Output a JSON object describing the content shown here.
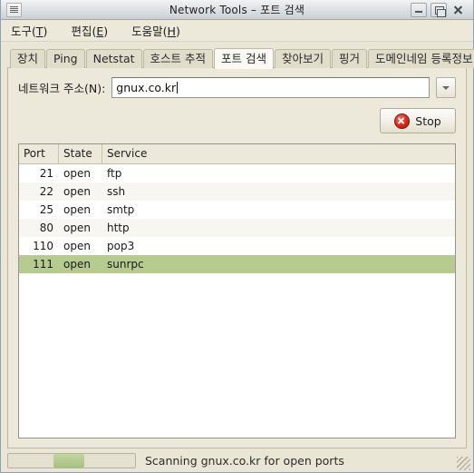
{
  "window": {
    "title": "Network Tools – 포트 검색",
    "menu_icon": "window-menu-icon",
    "minimize_icon": "minimize-icon",
    "maximize_icon": "maximize-icon",
    "close_icon": "close-icon"
  },
  "menubar": [
    {
      "label": "도구",
      "mnemonic": "T"
    },
    {
      "label": "편집",
      "mnemonic": "E"
    },
    {
      "label": "도움말",
      "mnemonic": "H"
    }
  ],
  "tabs": [
    {
      "label": "장치",
      "active": false
    },
    {
      "label": "Ping",
      "active": false
    },
    {
      "label": "Netstat",
      "active": false
    },
    {
      "label": "호스트 추적",
      "active": false
    },
    {
      "label": "포트 검색",
      "active": true
    },
    {
      "label": "찾아보기",
      "active": false
    },
    {
      "label": "핑거",
      "active": false
    },
    {
      "label": "도메인네임 등록정보",
      "active": false
    }
  ],
  "address": {
    "label": "네트워크 주소(N):",
    "mnemonic": "N",
    "value": "gnux.co.kr",
    "placeholder": "",
    "dropdown_icon": "chevron-down-icon"
  },
  "action": {
    "stop_label": "Stop",
    "stop_icon": "stop-circle-x-icon"
  },
  "results": {
    "columns": [
      "Port",
      "State",
      "Service"
    ],
    "rows": [
      {
        "port": "21",
        "state": "open",
        "service": "ftp",
        "selected": false
      },
      {
        "port": "22",
        "state": "open",
        "service": "ssh",
        "selected": false
      },
      {
        "port": "25",
        "state": "open",
        "service": "smtp",
        "selected": false
      },
      {
        "port": "80",
        "state": "open",
        "service": "http",
        "selected": false
      },
      {
        "port": "110",
        "state": "open",
        "service": "pop3",
        "selected": false
      },
      {
        "port": "111",
        "state": "open",
        "service": "sunrpc",
        "selected": true
      }
    ]
  },
  "status": {
    "message": "Scanning gnux.co.kr for open ports",
    "progress_percent": 36,
    "progress_chunk_width_percent": 24,
    "resize_grip_icon": "resize-grip-icon"
  },
  "colors": {
    "selection_green": "#b6cc8e",
    "progress_green": "#a8c181",
    "body_beige": "#e9e6d6",
    "tab_active": "#faf9f4",
    "stop_red": "#d92b1c"
  }
}
